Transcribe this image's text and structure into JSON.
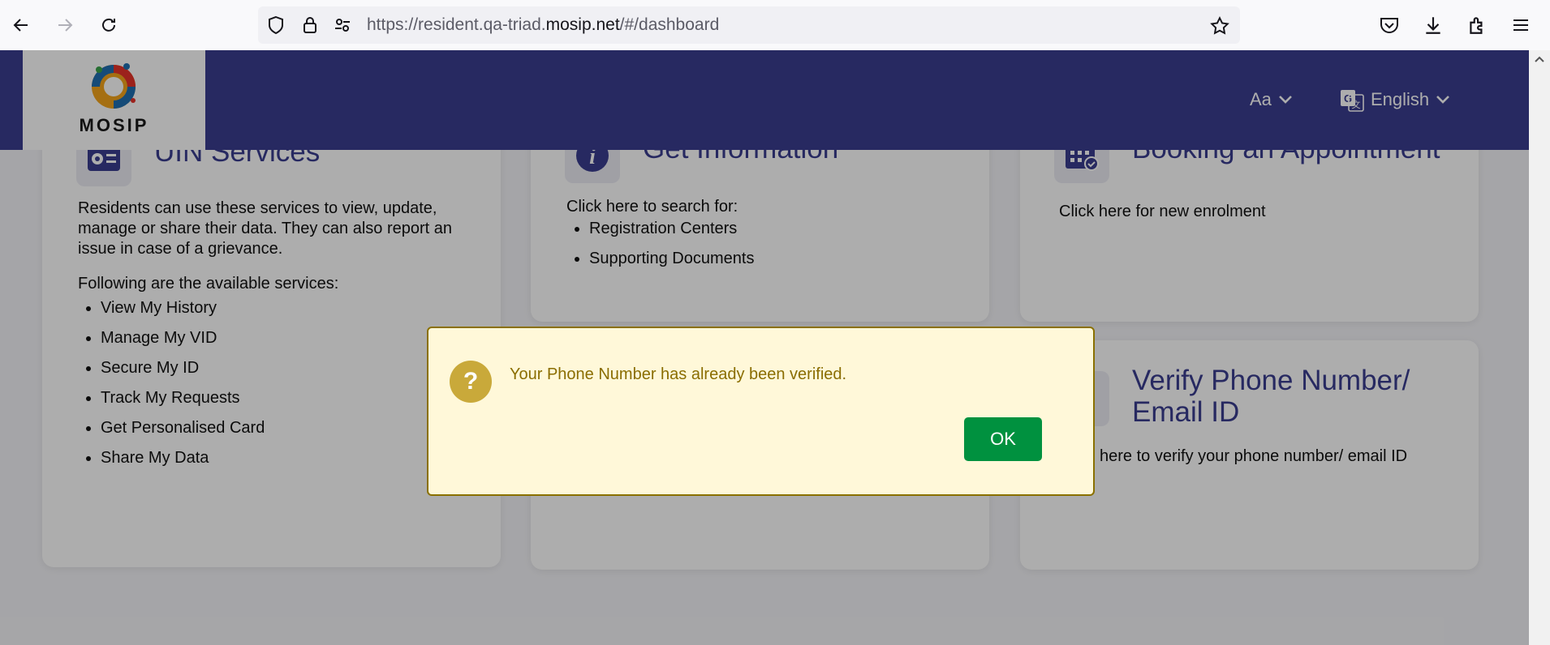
{
  "browser": {
    "url_prefix": "https://resident.qa-triad.",
    "url_domain": "mosip.net",
    "url_suffix": "/#/dashboard"
  },
  "header": {
    "logo_text": "MOSIP",
    "font_size_label": "Aa",
    "language": "English"
  },
  "cards": {
    "uin": {
      "title": "UIN Services",
      "description": "Residents can use these services to view, update, manage or share their data. They can also report an issue in case of a grievance.",
      "list_intro": "Following are the available services:",
      "services": [
        "View My History",
        "Manage My VID",
        "Secure My ID",
        "Track My Requests",
        "Get Personalised Card",
        "Share My Data"
      ]
    },
    "info": {
      "title": "Get Information",
      "intro": "Click here to search for:",
      "items": [
        "Registration Centers",
        "Supporting Documents"
      ]
    },
    "booking": {
      "title": "Booking an Appointment",
      "text": "Click here for new enrolment"
    },
    "verify": {
      "title_line1": "Verify Phone Number/",
      "title_line2": "Email ID",
      "text": "here to verify your phone number/ email ID"
    }
  },
  "dialog": {
    "message": "Your Phone Number has already been verified.",
    "ok_label": "OK"
  },
  "colors": {
    "header_bg": "#3a3d8f",
    "dialog_bg": "#fff8d9",
    "ok_button": "#00913f"
  }
}
